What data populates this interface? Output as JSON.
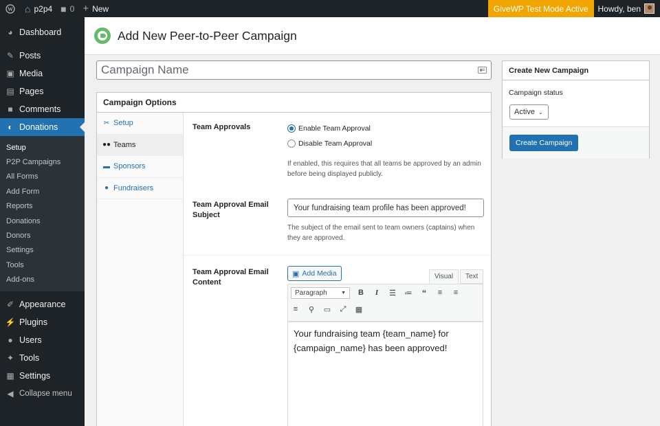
{
  "adminbar": {
    "site_name": "p2p4",
    "comment_count": "0",
    "new_label": "New",
    "test_mode": "GiveWP Test Mode Active",
    "howdy": "Howdy, ben"
  },
  "sidebar": {
    "top_items": [
      {
        "label": "Dashboard",
        "icon": "dashboard-icon"
      }
    ],
    "items": [
      {
        "label": "Posts",
        "icon": "pin-icon"
      },
      {
        "label": "Media",
        "icon": "media-icon"
      },
      {
        "label": "Pages",
        "icon": "pages-icon"
      },
      {
        "label": "Comments",
        "icon": "comments-icon"
      },
      {
        "label": "Donations",
        "icon": "give-icon"
      }
    ],
    "submenu": [
      "Setup",
      "P2P Campaigns",
      "All Forms",
      "Add Form",
      "Reports",
      "Donations",
      "Donors",
      "Settings",
      "Tools",
      "Add-ons"
    ],
    "bottom_items": [
      {
        "label": "Appearance",
        "icon": "brush-icon"
      },
      {
        "label": "Plugins",
        "icon": "plug-icon"
      },
      {
        "label": "Users",
        "icon": "user-icon"
      },
      {
        "label": "Tools",
        "icon": "wrench-icon"
      },
      {
        "label": "Settings",
        "icon": "sliders-icon"
      },
      {
        "label": "Collapse menu",
        "icon": "collapse-icon"
      }
    ]
  },
  "header": {
    "title": "Add New Peer-to-Peer Campaign"
  },
  "campaign_name": {
    "placeholder": "Campaign Name"
  },
  "options": {
    "title": "Campaign Options",
    "tabs": [
      {
        "label": "Setup",
        "icon": "wrench-icon"
      },
      {
        "label": "Teams",
        "icon": "group-icon"
      },
      {
        "label": "Sponsors",
        "icon": "id-card-icon"
      },
      {
        "label": "Fundraisers",
        "icon": "user-icon"
      }
    ],
    "team_approvals": {
      "label": "Team Approvals",
      "enable": "Enable Team Approval",
      "disable": "Disable Team Approval",
      "desc": "If enabled, this requires that all teams be approved by an admin before being displayed publicly."
    },
    "email_subject": {
      "label": "Team Approval Email Subject",
      "value": "Your fundraising team profile has been approved!",
      "desc": "The subject of the email sent to team owners (captains) when they are approved."
    },
    "email_content": {
      "label": "Team Approval Email Content",
      "add_media": "Add Media",
      "tab_visual": "Visual",
      "tab_text": "Text",
      "paragraph": "Paragraph",
      "content": "Your fundraising team {team_name} for {campaign_name} has been approved!"
    }
  },
  "publish": {
    "title": "Create New Campaign",
    "status_label": "Campaign status",
    "status_value": "Active",
    "button": "Create Campaign"
  },
  "colors": {
    "admin_dark": "#1d2327",
    "accent": "#2271b1",
    "test_mode": "#f0a500",
    "give_green": "#66bb6a"
  }
}
